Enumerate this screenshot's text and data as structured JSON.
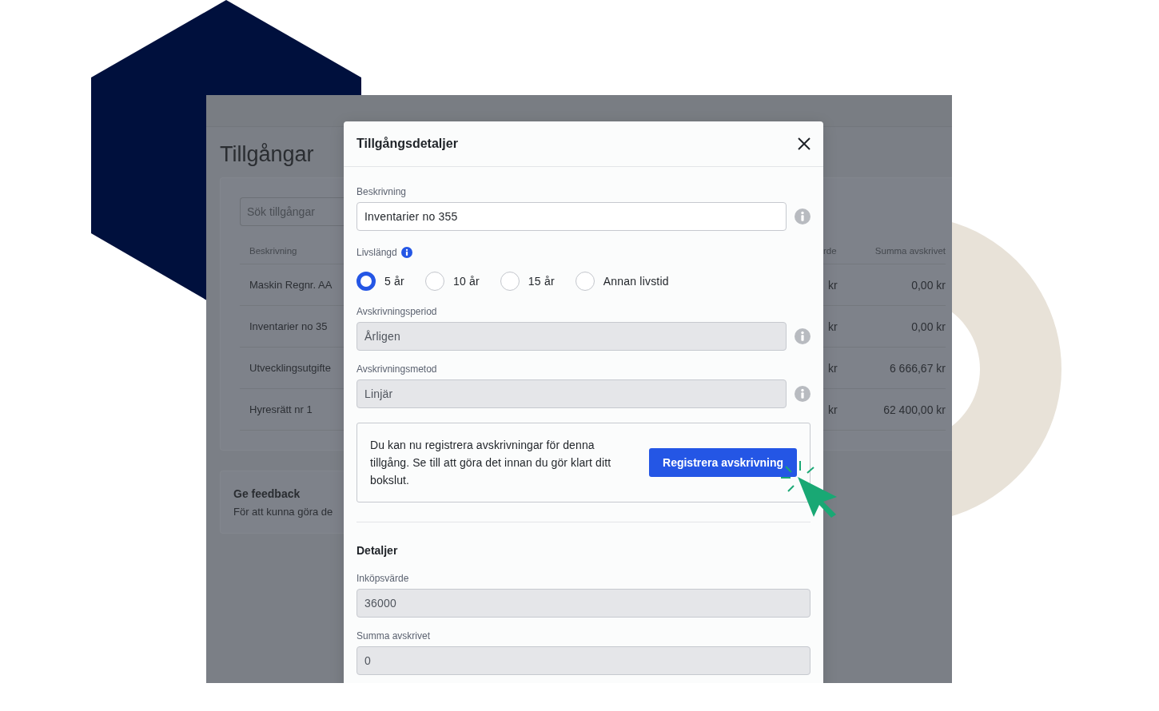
{
  "background_app": {
    "page_title": "Tillgångar",
    "search": {
      "placeholder": "Sök tillgångar"
    },
    "table": {
      "columns": [
        "Beskrivning",
        "rde",
        "Summa avskrivet"
      ],
      "rows": [
        {
          "cells": [
            "Maskin Regnr. AA",
            "kr",
            "0,00 kr"
          ]
        },
        {
          "cells": [
            "Inventarier no 35",
            "kr",
            "0,00 kr"
          ]
        },
        {
          "cells": [
            "Utvecklingsutgifte",
            "kr",
            "6 666,67 kr"
          ]
        },
        {
          "cells": [
            "Hyresrätt nr 1",
            "kr",
            "62 400,00 kr"
          ]
        }
      ]
    },
    "feedback": {
      "title": "Ge feedback",
      "text": "För att kunna göra de"
    }
  },
  "dialog": {
    "title": "Tillgångsdetaljer",
    "description": {
      "label": "Beskrivning",
      "value": "Inventarier no 355",
      "disabled": false,
      "info": true
    },
    "lifespan": {
      "label": "Livslängd",
      "options": [
        {
          "label": "5 år",
          "selected": true
        },
        {
          "label": "10 år",
          "selected": false
        },
        {
          "label": "15 år",
          "selected": false
        },
        {
          "label": "Annan livstid",
          "selected": false
        }
      ]
    },
    "fields": [
      {
        "label": "Avskrivningsperiod",
        "value": "Årligen",
        "disabled": true,
        "info": true
      },
      {
        "label": "Avskrivningsmetod",
        "value": "Linjär",
        "disabled": true,
        "info": true
      }
    ],
    "notice": {
      "text": "Du kan nu registrera avskrivningar för denna tillgång. Se till att göra det innan du gör klart ditt bokslut.",
      "button": "Registrera avskrivning"
    },
    "details": {
      "heading": "Detaljer",
      "fields": [
        {
          "label": "Inköpsvärde",
          "value": "36000",
          "disabled": true,
          "info": false
        },
        {
          "label": "Summa avskrivet",
          "value": "0",
          "disabled": true,
          "info": false
        }
      ]
    }
  }
}
